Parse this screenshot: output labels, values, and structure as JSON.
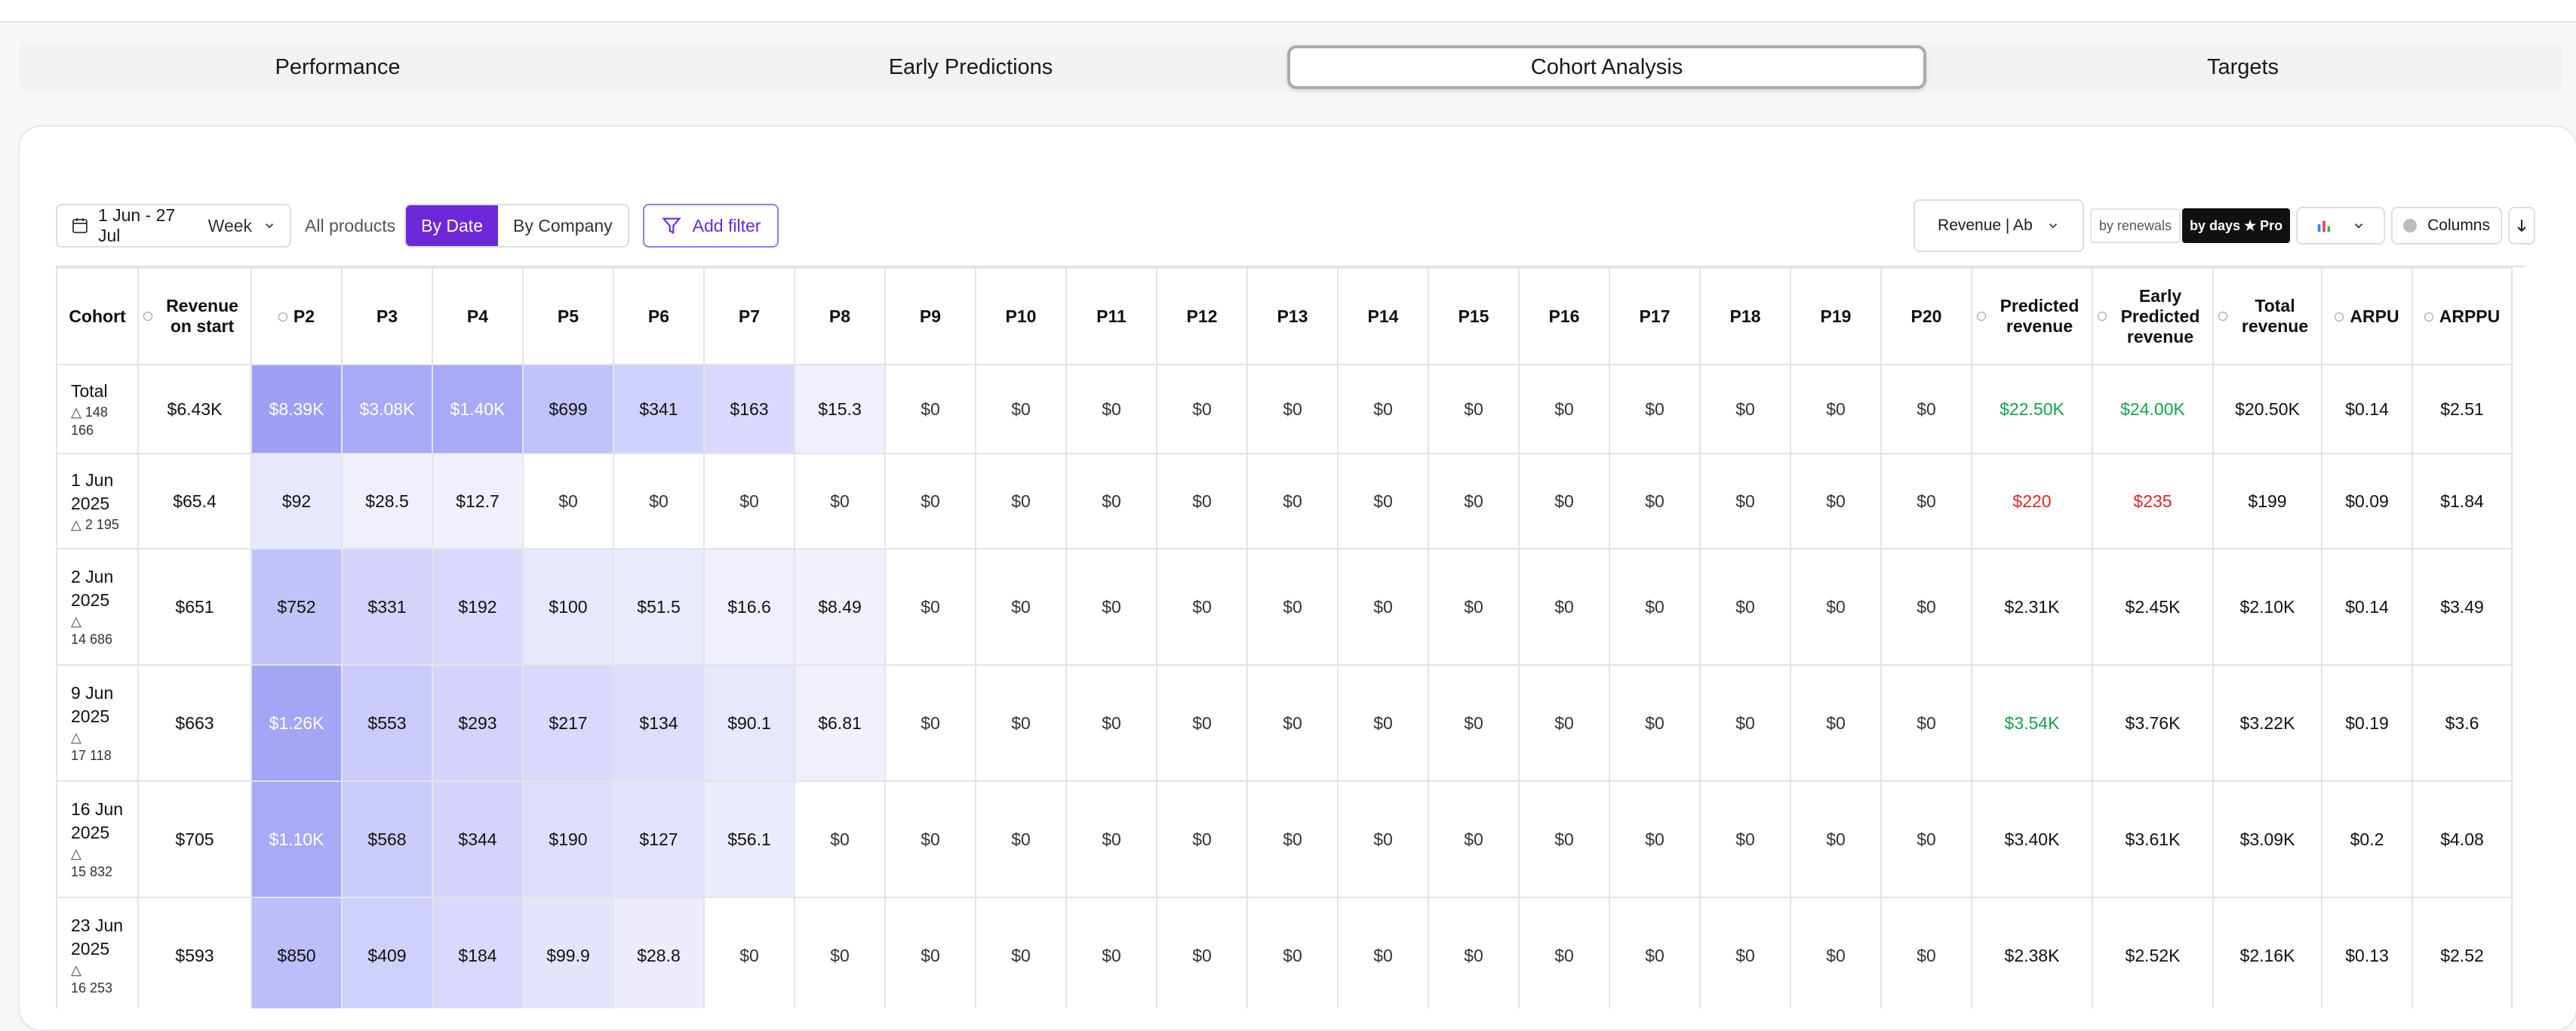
{
  "tabs": [
    {
      "label": "Performance",
      "active": false
    },
    {
      "label": "Early Predictions",
      "active": false
    },
    {
      "label": "Cohort Analysis",
      "active": true
    },
    {
      "label": "Targets",
      "active": false
    }
  ],
  "toolbar": {
    "date_range": "1 Jun - 27 Jul",
    "granularity": "Week",
    "products": "All products",
    "group_by": [
      "By Date",
      "By Company"
    ],
    "group_by_active": "By Date",
    "add_filter": "Add filter",
    "metric_select": "Revenue | Ab",
    "by_renewals": "by renewals",
    "by_days_pro": "by days ★ Pro",
    "columns": "Columns",
    "accent_color": "#6d28d9"
  },
  "table": {
    "headers": [
      {
        "label": "Cohort",
        "circle": false
      },
      {
        "label": "Revenue on start",
        "circle": true
      },
      {
        "label": "P2",
        "circle": true
      },
      {
        "label": "P3",
        "circle": false
      },
      {
        "label": "P4",
        "circle": false
      },
      {
        "label": "P5",
        "circle": false
      },
      {
        "label": "P6",
        "circle": false
      },
      {
        "label": "P7",
        "circle": false
      },
      {
        "label": "P8",
        "circle": false
      },
      {
        "label": "P9",
        "circle": false
      },
      {
        "label": "P10",
        "circle": false
      },
      {
        "label": "P11",
        "circle": false
      },
      {
        "label": "P12",
        "circle": false
      },
      {
        "label": "P13",
        "circle": false
      },
      {
        "label": "P14",
        "circle": false
      },
      {
        "label": "P15",
        "circle": false
      },
      {
        "label": "P16",
        "circle": false
      },
      {
        "label": "P17",
        "circle": false
      },
      {
        "label": "P18",
        "circle": false
      },
      {
        "label": "P19",
        "circle": false
      },
      {
        "label": "P20",
        "circle": false
      },
      {
        "label": "Predicted revenue",
        "circle": true
      },
      {
        "label": "Early Predicted revenue",
        "circle": true
      },
      {
        "label": "Total revenue",
        "circle": true
      },
      {
        "label": "ARPU",
        "circle": true
      },
      {
        "label": "ARPPU",
        "circle": true
      }
    ],
    "rows": [
      {
        "cohort": "Total",
        "users": "148 166",
        "revenue_on_start": "$6.43K",
        "periods": [
          "$8.39K",
          "$3.08K",
          "$1.40K",
          "$699",
          "$341",
          "$163",
          "$15.3",
          "$0",
          "$0",
          "$0",
          "$0",
          "$0",
          "$0",
          "$0",
          "$0",
          "$0",
          "$0",
          "$0",
          "$0"
        ],
        "heat": [
          0.9,
          0.8,
          0.8,
          0.55,
          0.4,
          0.3,
          0.07,
          0,
          0,
          0,
          0,
          0,
          0,
          0,
          0,
          0,
          0,
          0,
          0
        ],
        "predicted": "$22.50K",
        "predicted_color": "green",
        "early_predicted": "$24.00K",
        "early_color": "green",
        "total": "$20.50K",
        "arpu": "$0.14",
        "arppu": "$2.51"
      },
      {
        "cohort": "1 Jun 2025",
        "users": "2 195",
        "revenue_on_start": "$65.4",
        "periods": [
          "$92",
          "$28.5",
          "$12.7",
          "$0",
          "$0",
          "$0",
          "$0",
          "$0",
          "$0",
          "$0",
          "$0",
          "$0",
          "$0",
          "$0",
          "$0",
          "$0",
          "$0",
          "$0",
          "$0"
        ],
        "heat": [
          0.15,
          0.07,
          0.07,
          0,
          0,
          0,
          0,
          0,
          0,
          0,
          0,
          0,
          0,
          0,
          0,
          0,
          0,
          0,
          0
        ],
        "predicted": "$220",
        "predicted_color": "red",
        "early_predicted": "$235",
        "early_color": "red",
        "total": "$199",
        "arpu": "$0.09",
        "arppu": "$1.84"
      },
      {
        "cohort": "2 Jun 2025",
        "users": "14 686",
        "revenue_on_start": "$651",
        "periods": [
          "$752",
          "$331",
          "$192",
          "$100",
          "$51.5",
          "$16.6",
          "$8.49",
          "$0",
          "$0",
          "$0",
          "$0",
          "$0",
          "$0",
          "$0",
          "$0",
          "$0",
          "$0",
          "$0",
          "$0"
        ],
        "heat": [
          0.55,
          0.35,
          0.3,
          0.15,
          0.12,
          0.07,
          0.05,
          0,
          0,
          0,
          0,
          0,
          0,
          0,
          0,
          0,
          0,
          0,
          0
        ],
        "predicted": "$2.31K",
        "predicted_color": "",
        "early_predicted": "$2.45K",
        "early_color": "",
        "total": "$2.10K",
        "arpu": "$0.14",
        "arppu": "$3.49"
      },
      {
        "cohort": "9 Jun 2025",
        "users": "17 118",
        "revenue_on_start": "$663",
        "periods": [
          "$1.26K",
          "$553",
          "$293",
          "$217",
          "$134",
          "$90.1",
          "$6.81",
          "$0",
          "$0",
          "$0",
          "$0",
          "$0",
          "$0",
          "$0",
          "$0",
          "$0",
          "$0",
          "$0",
          "$0"
        ],
        "heat": [
          0.85,
          0.45,
          0.35,
          0.3,
          0.25,
          0.15,
          0.05,
          0,
          0,
          0,
          0,
          0,
          0,
          0,
          0,
          0,
          0,
          0,
          0
        ],
        "predicted": "$3.54K",
        "predicted_color": "green",
        "early_predicted": "$3.76K",
        "early_color": "",
        "total": "$3.22K",
        "arpu": "$0.19",
        "arppu": "$3.6"
      },
      {
        "cohort": "16 Jun 2025",
        "users": "15 832",
        "revenue_on_start": "$705",
        "periods": [
          "$1.10K",
          "$568",
          "$344",
          "$190",
          "$127",
          "$56.1",
          "$0",
          "$0",
          "$0",
          "$0",
          "$0",
          "$0",
          "$0",
          "$0",
          "$0",
          "$0",
          "$0",
          "$0",
          "$0"
        ],
        "heat": [
          0.8,
          0.45,
          0.35,
          0.25,
          0.2,
          0.12,
          0,
          0,
          0,
          0,
          0,
          0,
          0,
          0,
          0,
          0,
          0,
          0,
          0
        ],
        "predicted": "$3.40K",
        "predicted_color": "",
        "early_predicted": "$3.61K",
        "early_color": "",
        "total": "$3.09K",
        "arpu": "$0.2",
        "arppu": "$4.08"
      },
      {
        "cohort": "23 Jun 2025",
        "users": "16 253",
        "revenue_on_start": "$593",
        "periods": [
          "$850",
          "$409",
          "$184",
          "$99.9",
          "$28.8",
          "$0",
          "$0",
          "$0",
          "$0",
          "$0",
          "$0",
          "$0",
          "$0",
          "$0",
          "$0",
          "$0",
          "$0",
          "$0",
          "$0"
        ],
        "heat": [
          0.6,
          0.4,
          0.3,
          0.18,
          0.1,
          0,
          0,
          0,
          0,
          0,
          0,
          0,
          0,
          0,
          0,
          0,
          0,
          0,
          0
        ],
        "predicted": "$2.38K",
        "predicted_color": "",
        "early_predicted": "$2.52K",
        "early_color": "",
        "total": "$2.16K",
        "arpu": "$0.13",
        "arppu": "$2.52"
      }
    ]
  }
}
